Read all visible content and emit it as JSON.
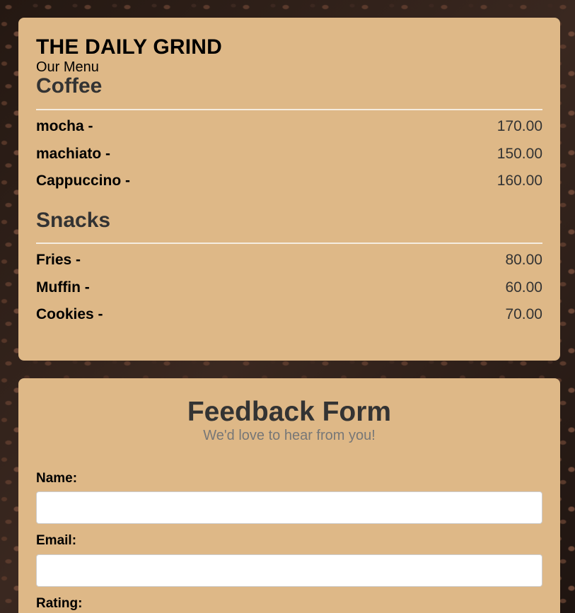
{
  "header": {
    "title": "THE DAILY GRIND",
    "subtitle": "Our Menu"
  },
  "menu": {
    "sections": [
      {
        "heading": "Coffee",
        "items": [
          {
            "name": "mocha -",
            "price": "170.00"
          },
          {
            "name": "machiato -",
            "price": "150.00"
          },
          {
            "name": "Cappuccino -",
            "price": "160.00"
          }
        ]
      },
      {
        "heading": "Snacks",
        "items": [
          {
            "name": "Fries -",
            "price": "80.00"
          },
          {
            "name": "Muffin -",
            "price": "60.00"
          },
          {
            "name": "Cookies -",
            "price": "70.00"
          }
        ]
      }
    ]
  },
  "feedback": {
    "title": "Feedback Form",
    "subtitle": "We'd love to hear from you!",
    "name_label": "Name:",
    "name_value": "",
    "email_label": "Email:",
    "email_value": "",
    "rating_label": "Rating:"
  },
  "colors": {
    "card_background": "#deb887",
    "heading_text": "#333333",
    "divider": "#f5ecdf"
  },
  "icons": {
    "background": "coffee-beans-texture"
  }
}
